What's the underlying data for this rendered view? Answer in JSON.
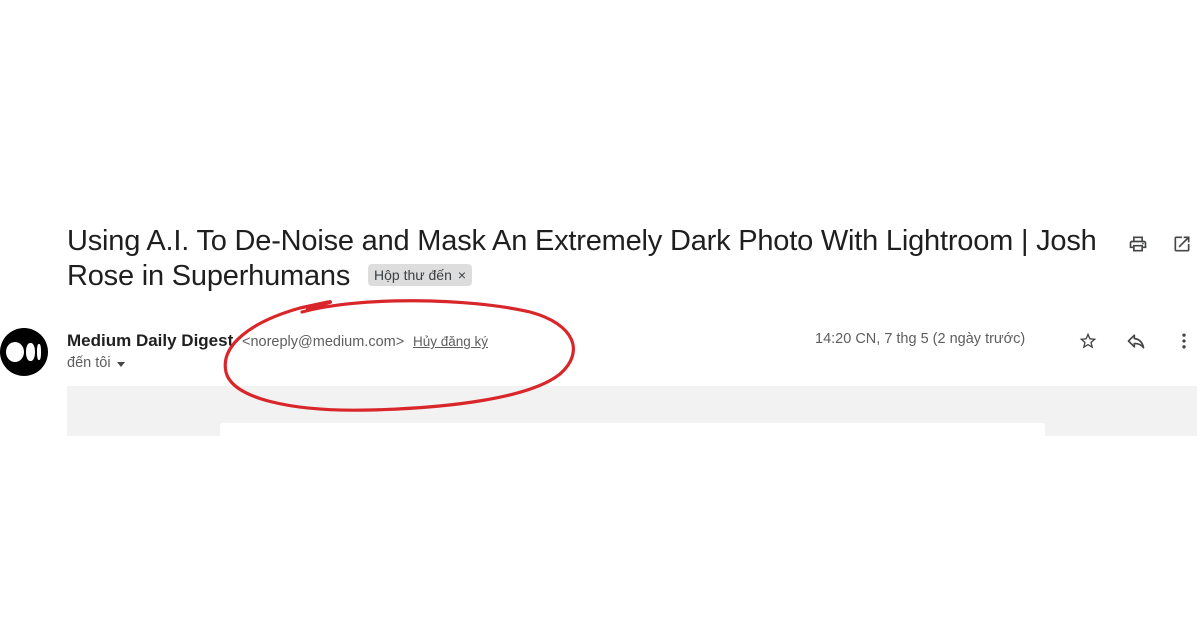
{
  "email": {
    "subject": "Using A.I. To De-Noise and Mask An Extremely Dark Photo With Lightroom | Josh Rose in Superhumans",
    "label": "Hộp thư đến",
    "label_remove": "×",
    "sender_name": "Medium Daily Digest",
    "sender_email": "<noreply@medium.com>",
    "unsubscribe": "Hủy đăng ký",
    "recipient": "đến tôi",
    "timestamp": "14:20 CN, 7 thg 5 (2 ngày trước)"
  },
  "icons": {
    "print": "print-icon",
    "open_new_window": "open-in-new-window-icon",
    "star": "star-icon",
    "reply": "reply-icon",
    "more": "more-vert-icon",
    "avatar": "medium-logo"
  },
  "colors": {
    "annotation": "#d9262a",
    "label_bg": "#dddddd",
    "body_bg": "#f2f2f2"
  }
}
